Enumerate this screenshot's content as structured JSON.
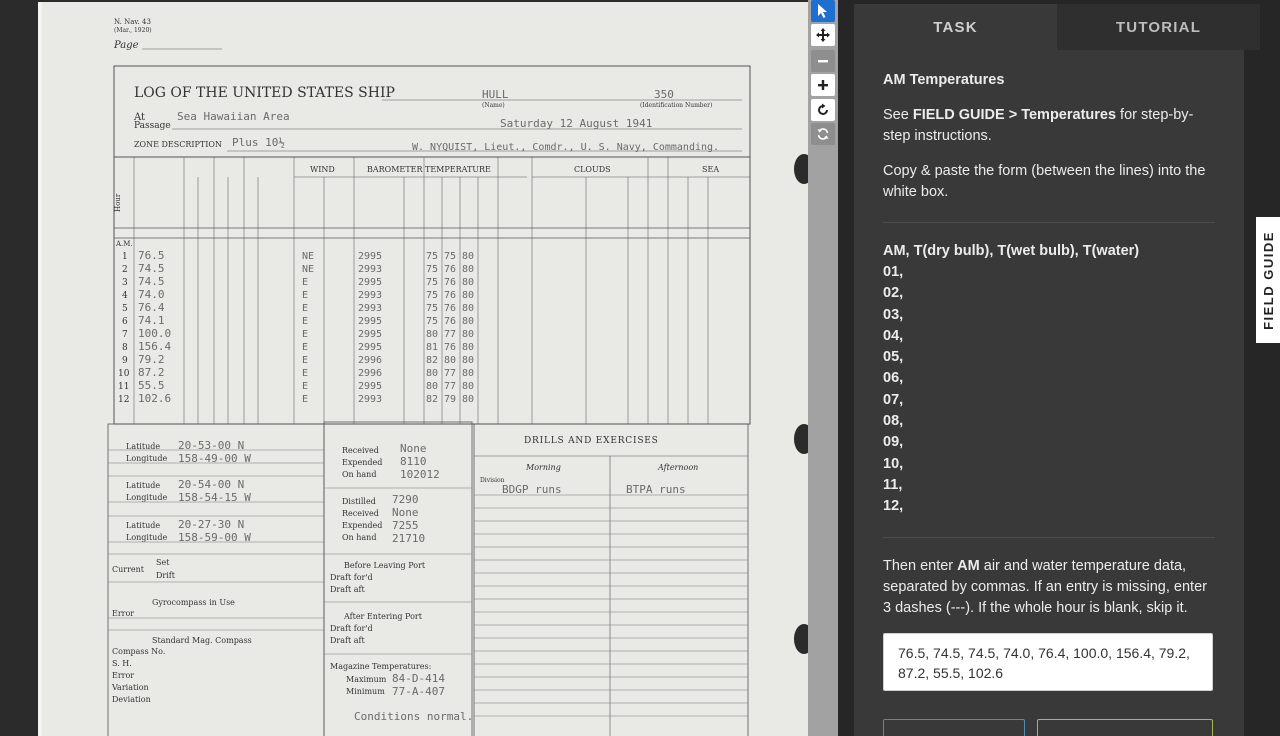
{
  "document": {
    "form_id": "N. Nav. 43",
    "form_date": "(Mar., 1920)",
    "page_label": "Page",
    "title": "LOG OF THE UNITED STATES SHIP",
    "ship_name": "HULL",
    "ship_number": "350",
    "name_caption": "(Name)",
    "id_caption": "(Identification Number)",
    "at_label": "At",
    "passage_label": "Passage",
    "location": "Sea  Hawaiian Area",
    "date_text": "Saturday    12  August  1941",
    "zone_label": "ZONE DESCRIPTION",
    "zone_value": "Plus 10½",
    "commanding": "W. NYQUIST, Lieut., Comdr., U. S. Navy, Commanding.",
    "col_hour": "Hour",
    "col_wind": "WIND",
    "col_barometer": "BAROMETER",
    "col_temperature": "TEMPERATURE",
    "col_clouds": "CLOUDS",
    "col_sea": "SEA",
    "am_label": "A.M.",
    "rows": [
      {
        "h": "1",
        "air": "76.5",
        "dir": "NE",
        "bar": "2995",
        "dry": "75",
        "wet": "75",
        "sea": "80"
      },
      {
        "h": "2",
        "air": "74.5",
        "dir": "NE",
        "bar": "2993",
        "dry": "75",
        "wet": "76",
        "sea": "80"
      },
      {
        "h": "3",
        "air": "74.5",
        "dir": "E",
        "bar": "2995",
        "dry": "75",
        "wet": "76",
        "sea": "80"
      },
      {
        "h": "4",
        "air": "74.0",
        "dir": "E",
        "bar": "2993",
        "dry": "75",
        "wet": "76",
        "sea": "80"
      },
      {
        "h": "5",
        "air": "76.4",
        "dir": "E",
        "bar": "2993",
        "dry": "75",
        "wet": "76",
        "sea": "80"
      },
      {
        "h": "6",
        "air": "74.1",
        "dir": "E",
        "bar": "2995",
        "dry": "75",
        "wet": "76",
        "sea": "80"
      },
      {
        "h": "7",
        "air": "100.0",
        "dir": "E",
        "bar": "2995",
        "dry": "80",
        "wet": "77",
        "sea": "80"
      },
      {
        "h": "8",
        "air": "156.4",
        "dir": "E",
        "bar": "2995",
        "dry": "81",
        "wet": "76",
        "sea": "80"
      },
      {
        "h": "9",
        "air": "79.2",
        "dir": "E",
        "bar": "2996",
        "dry": "82",
        "wet": "80",
        "sea": "80"
      },
      {
        "h": "10",
        "air": "87.2",
        "dir": "E",
        "bar": "2996",
        "dry": "80",
        "wet": "77",
        "sea": "80"
      },
      {
        "h": "11",
        "air": "55.5",
        "dir": "E",
        "bar": "2995",
        "dry": "80",
        "wet": "77",
        "sea": "80"
      },
      {
        "h": "12",
        "air": "102.6",
        "dir": "E",
        "bar": "2993",
        "dry": "82",
        "wet": "79",
        "sea": "80"
      }
    ],
    "latitude_label": "Latitude",
    "longitude_label": "Longitude",
    "lat_8am": "20-53-00 N",
    "lon_8am": "158-49-00 W",
    "lat_noon": "20-54-00 N",
    "lon_noon": "158-54-15 W",
    "lat_8pm": "20-27-30 N",
    "lon_8pm": "158-59-00 W",
    "current_label": "Current",
    "set_label": "Set",
    "drift_label": "Drift",
    "error_label": "Error",
    "gyrocompass_label": "Gyrocompass in Use",
    "std_compass_label": "Standard Mag. Compass",
    "compass_no_label": "Compass No.",
    "sh_label": "S. H.",
    "variation_label": "Variation",
    "deviation_label": "Deviation",
    "received_label": "Received",
    "expended_label": "Expended",
    "on_hand_label": "On hand",
    "distilled_label": "Distilled",
    "fuel_received": "None",
    "fuel_expended": "8110",
    "fuel_on_hand": "102012",
    "water_distilled": "7290",
    "water_received": "None",
    "water_expended": "7255",
    "water_on_hand": "21710",
    "before_leaving": "Before Leaving Port",
    "after_entering": "After Entering Port",
    "draft_ford": "Draft for'd",
    "draft_aft": "Draft aft",
    "magazine_label": "Magazine Temperatures:",
    "maximum_label": "Maximum",
    "minimum_label": "Minimum",
    "max_value": "84-D-414",
    "min_value": "77-A-407",
    "conditions": "Conditions normal.",
    "drills_title": "DRILLS AND EXERCISES",
    "morning": "Morning",
    "afternoon": "Afternoon",
    "division_label": "Division",
    "drill_morning": "BDGP runs",
    "drill_afternoon": "BTPA runs"
  },
  "toolbar": {
    "items": [
      "pointer-icon",
      "move-icon",
      "zoom-out-icon",
      "zoom-in-icon",
      "rotate-icon",
      "refresh-icon"
    ]
  },
  "panel": {
    "tabs": [
      {
        "label": "TASK"
      },
      {
        "label": "TUTORIAL"
      }
    ],
    "heading": "AM Temperatures",
    "instr1_pre": "See ",
    "instr1_bold": "FIELD GUIDE > Temperatures",
    "instr1_post": " for step-by-step instructions.",
    "instr2": "Copy & paste the form (between the lines) into the white box.",
    "form_header": "AM, T(dry bulb), T(wet bulb), T(water)",
    "form_lines": [
      "01,",
      "02,",
      "03,",
      "04,",
      "05,",
      "06,",
      "07,",
      "08,",
      "09,",
      "10,",
      "11,",
      "12,"
    ],
    "instr3_pre": "Then enter ",
    "instr3_bold": "AM",
    "instr3_post": " air and water temperature data, separated by commas. If an entry is missing, enter 3 dashes (---). If the whole hour is blank, skip it.",
    "answer_value": "76.5, 74.5, 74.5, 74.0, 76.4, 100.0, 156.4, 79.2, 87.2, 55.5, 102.6"
  },
  "field_guide": {
    "label": "FIELD GUIDE"
  }
}
